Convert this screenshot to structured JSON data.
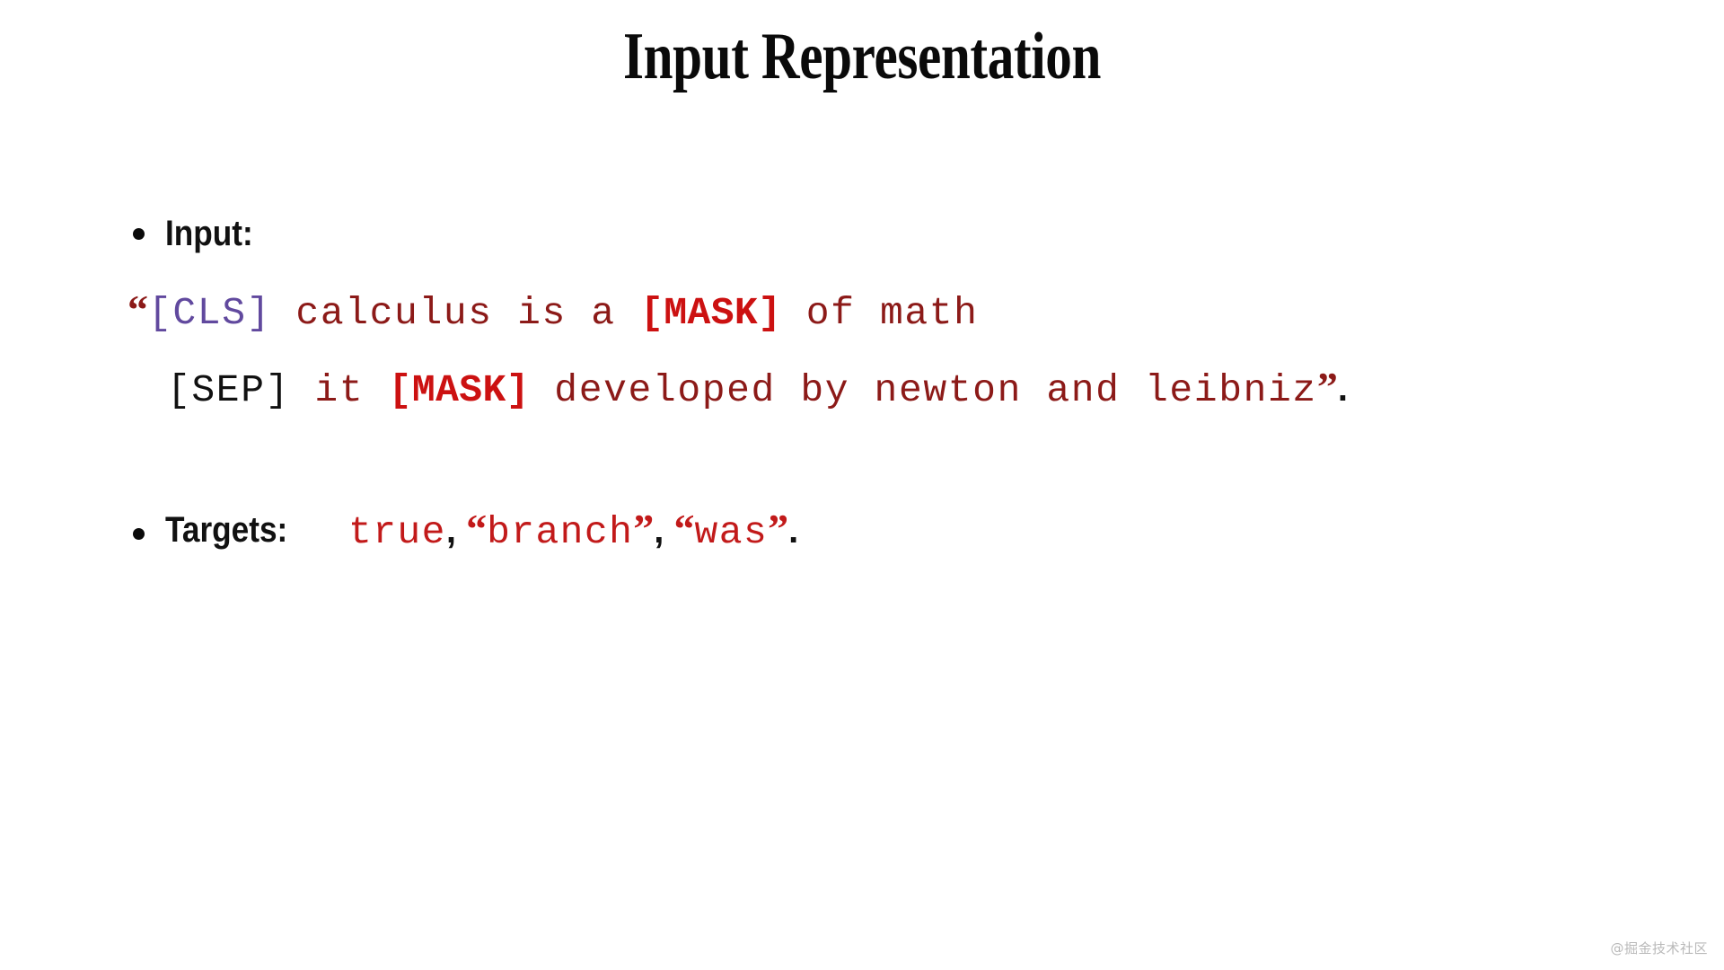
{
  "slide": {
    "title": "Input Representation",
    "background_color": "#ffffff"
  },
  "colors": {
    "title": "#0a0a0a",
    "body_red": "#8C1A18",
    "mask_red": "#CC1111",
    "cls_purple": "#61499E",
    "sep_black": "#111111",
    "target_red": "#C21A1A",
    "watermark": "#b9b9b9"
  },
  "input_section": {
    "bullet_label": "Input:",
    "line1": {
      "open_quote": "“",
      "cls_token": "[CLS]",
      "text_a": " calculus is a ",
      "mask_token": "[MASK]",
      "text_b": " of math"
    },
    "line2": {
      "sep_token": "[SEP]",
      "text_a": " it ",
      "mask_token": "[MASK]",
      "text_b": " developed by newton and leibniz",
      "close_quote": "”",
      "period": "."
    }
  },
  "targets_section": {
    "bullet_label": "Targets:",
    "value1": "true",
    "sep1": ", ",
    "value2_open_quote": "“",
    "value2": "branch",
    "value2_close_quote": "”",
    "sep2": ", ",
    "value3_open_quote": "“",
    "value3": "was",
    "value3_close_quote": "”",
    "period": "."
  },
  "watermark": {
    "text": "@掘金技术社区"
  }
}
